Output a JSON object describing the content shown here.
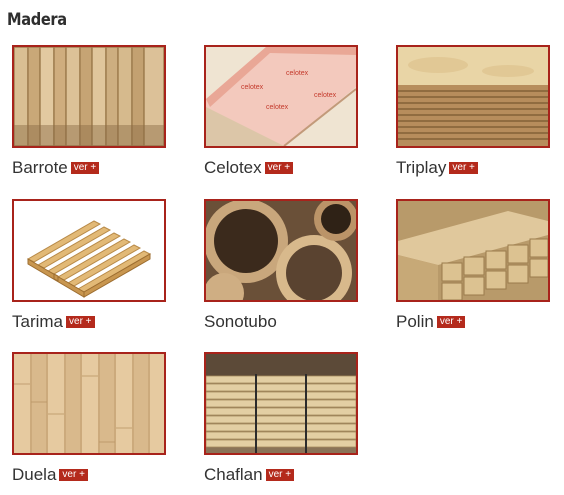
{
  "section": {
    "title": "Madera"
  },
  "ver_label": "ver +",
  "products": [
    {
      "name": "Barrote",
      "image": "barrote-image"
    },
    {
      "name": "Celotex",
      "image": "celotex-image"
    },
    {
      "name": "Triplay",
      "image": "triplay-image"
    },
    {
      "name": "Tarima",
      "image": "tarima-image"
    },
    {
      "name": "Sonotubo",
      "image": "sonotubo-image"
    },
    {
      "name": "Polin",
      "image": "polin-image"
    },
    {
      "name": "Duela",
      "image": "duela-image"
    },
    {
      "name": "Chaflan",
      "image": "chaflan-image"
    }
  ],
  "colors": {
    "accent": "#b42a1c",
    "border": "#a8231b",
    "text": "#333333"
  }
}
